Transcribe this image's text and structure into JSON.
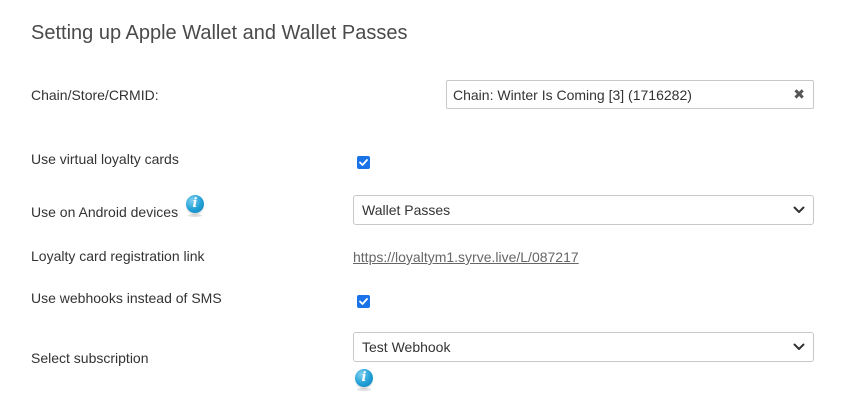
{
  "page": {
    "title": "Setting up Apple Wallet and Wallet Passes"
  },
  "form": {
    "chain_label": "Chain/Store/CRMID:",
    "chain_value": "Chain: Winter Is Coming [3] (1716282)",
    "chain_clear_icon": "close-icon",
    "virtual_cards_label": "Use virtual loyalty cards",
    "virtual_cards_checked": true,
    "android_label": "Use on Android devices",
    "android_info_icon": "info-icon",
    "android_select_value": "Wallet Passes",
    "registration_link_label": "Loyalty card registration link",
    "registration_link": "https://loyaltym1.syrve.live/L/087217",
    "webhooks_label": "Use webhooks instead of SMS",
    "webhooks_checked": true,
    "subscription_label": "Select subscription",
    "subscription_select_value": "Test Webhook",
    "subscription_info_icon": "info-icon"
  },
  "colors": {
    "checkbox": "#1a73e8",
    "info_icon": "#1f9fd6",
    "link": "#666666"
  }
}
